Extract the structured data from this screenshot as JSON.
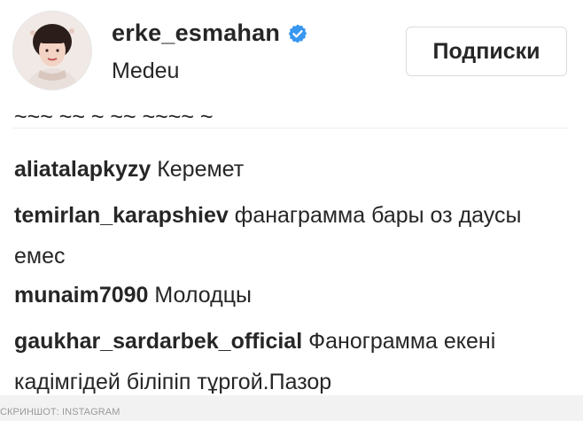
{
  "post_header": {
    "username": "erke_esmahan",
    "verified_icon": "verified-badge-icon",
    "location": "Medeu",
    "follow_button_label": "Подписки"
  },
  "comments": {
    "cut_off_top_text": "~~~ ~~ ~ ~~ ~~~~ ~",
    "items": [
      {
        "author": "aliatalapkyzy",
        "text": "Керемет"
      },
      {
        "author": "temirlan_karapshiev",
        "text": "фанаграмма бары оз даусы емес"
      },
      {
        "author": "munaim7090",
        "text": "Молодцы"
      },
      {
        "author": "gaukhar_sardarbek_official",
        "text": "Фанограмма екені кадімгідей біліпіп тұргой.Пазор"
      }
    ]
  },
  "footer": {
    "caption": "СКРИНШОТ: INSTAGRAM"
  },
  "colors": {
    "text": "#262626",
    "verified_blue": "#3897f0",
    "button_border": "#dbdbdb",
    "caption_gray": "#9a9a9a"
  }
}
